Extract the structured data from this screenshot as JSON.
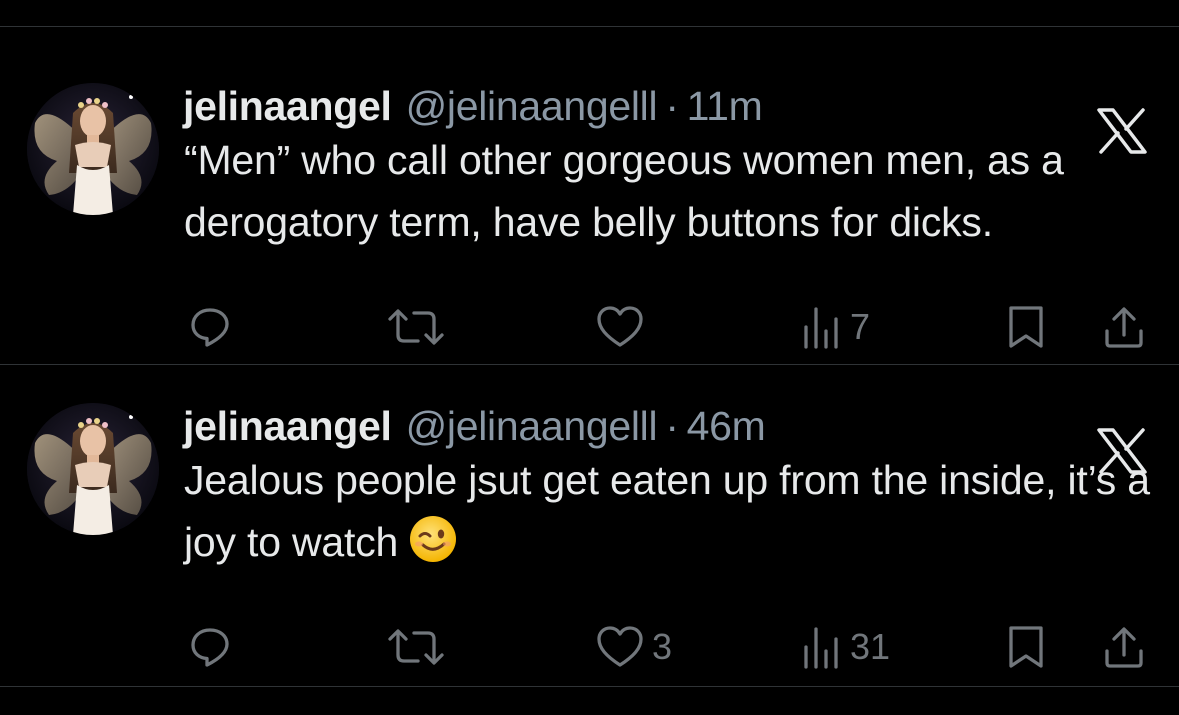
{
  "colors": {
    "background": "#000000",
    "primary_text": "#e7e9ea",
    "secondary_text": "#8b98a5",
    "icon": "#71767b",
    "divider": "#2f3336",
    "emoji_yellow": "#ffcc33"
  },
  "tweets": [
    {
      "display_name": "jelinaangel",
      "handle": "@jelinaangelll",
      "separator": "·",
      "time": "11m",
      "text": "“Men” who call other gorgeous women men, as a derogatory term, have belly buttons for dicks.",
      "emoji": "",
      "emoji_icon": "",
      "reply_count": "",
      "retweet_count": "",
      "like_count": "",
      "views_count": "7",
      "icons": [
        "reply-icon",
        "retweet-icon",
        "like-icon",
        "views-icon",
        "bookmark-icon",
        "share-icon",
        "x-logo-icon"
      ]
    },
    {
      "display_name": "jelinaangel",
      "handle": "@jelinaangelll",
      "separator": "·",
      "time": "46m",
      "text": "Jealous people jsut get eaten up from the inside, it’s a joy to watch",
      "emoji": "😉",
      "emoji_icon": "winking-face-emoji",
      "reply_count": "",
      "retweet_count": "",
      "like_count": "3",
      "views_count": "31",
      "icons": [
        "reply-icon",
        "retweet-icon",
        "like-icon",
        "views-icon",
        "bookmark-icon",
        "share-icon",
        "x-logo-icon"
      ]
    }
  ]
}
